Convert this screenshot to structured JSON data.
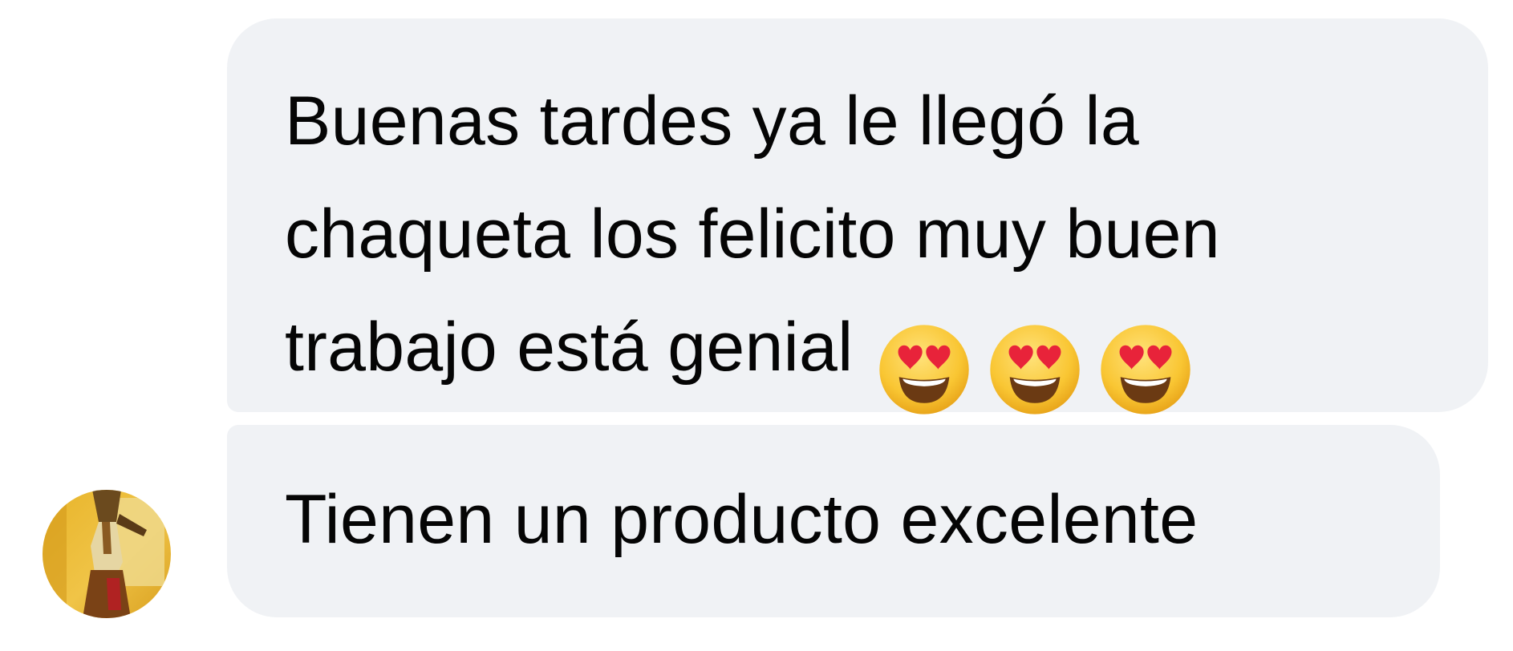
{
  "conversation": {
    "messages": [
      {
        "lines": [
          "Buenas tardes ya le llegó la",
          "chaqueta los felicito muy buen",
          "trabajo está genial"
        ],
        "emojis": [
          "heart-eyes-emoji",
          "heart-eyes-emoji",
          "heart-eyes-emoji"
        ]
      },
      {
        "text": "Tienen un producto excelente"
      }
    ],
    "sender": {
      "avatar_icon": "user-avatar"
    }
  },
  "colors": {
    "bubble_background": "#f0f2f5",
    "text": "#050505",
    "emoji_face": "#f9c633",
    "emoji_hearts": "#e8233a"
  }
}
